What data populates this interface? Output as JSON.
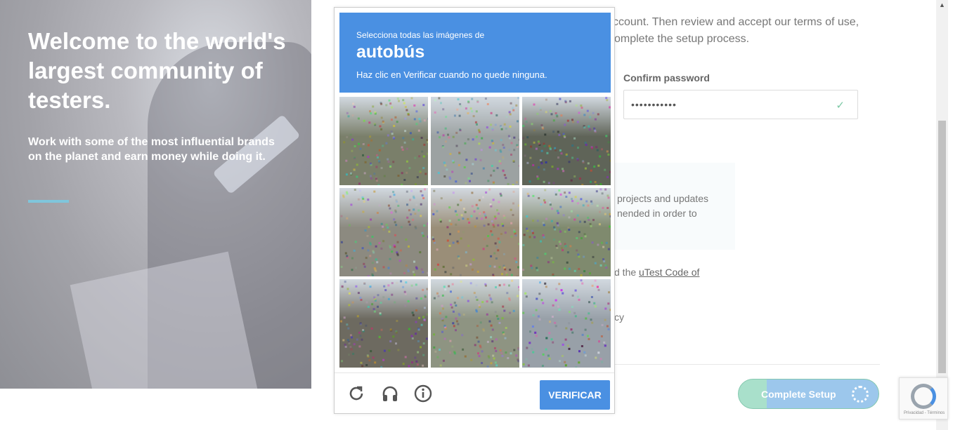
{
  "hero": {
    "heading": "Welcome to the world's largest community of testers.",
    "subtext": "Work with some of the most influential brands on the planet and earn money while doing it."
  },
  "form": {
    "intro_line1": "ccount. Then review and accept our terms of use,",
    "intro_line2": "omplete the setup process.",
    "confirm_label": "Confirm password",
    "confirm_value": "•••••••••••",
    "notice_line1": "projects and updates",
    "notice_line2": "nended in order to",
    "code_text": "d the ",
    "code_link": "uTest Code of",
    "policy_text": "cy",
    "setup_button": "Complete Setup"
  },
  "captcha": {
    "instruction": "Selecciona todas las imágenes de",
    "object": "autobús",
    "subinstruction": "Haz clic en Verificar cuando no quede ninguna.",
    "verify_button": "VERIFICAR",
    "tiles": [
      {
        "scene": "street-corner-traffic-light",
        "bg": "#7a7f6a"
      },
      {
        "scene": "intersection-road",
        "bg": "#9ca2a2"
      },
      {
        "scene": "white-bus",
        "bg": "#5f6458"
      },
      {
        "scene": "school-bus-parking",
        "bg": "#8c8a80"
      },
      {
        "scene": "desert-tree",
        "bg": "#9a8e78"
      },
      {
        "scene": "roadside-grass",
        "bg": "#7f8a6e"
      },
      {
        "scene": "hillside",
        "bg": "#6d6a60"
      },
      {
        "scene": "tree-lined-road",
        "bg": "#8e9482"
      },
      {
        "scene": "city-bus-stop-sign",
        "bg": "#98a0a8"
      }
    ]
  },
  "badge": {
    "terms": "Privacidad - Términos"
  },
  "colors": {
    "accent": "#4a90e2",
    "check": "#7bc8a4"
  }
}
